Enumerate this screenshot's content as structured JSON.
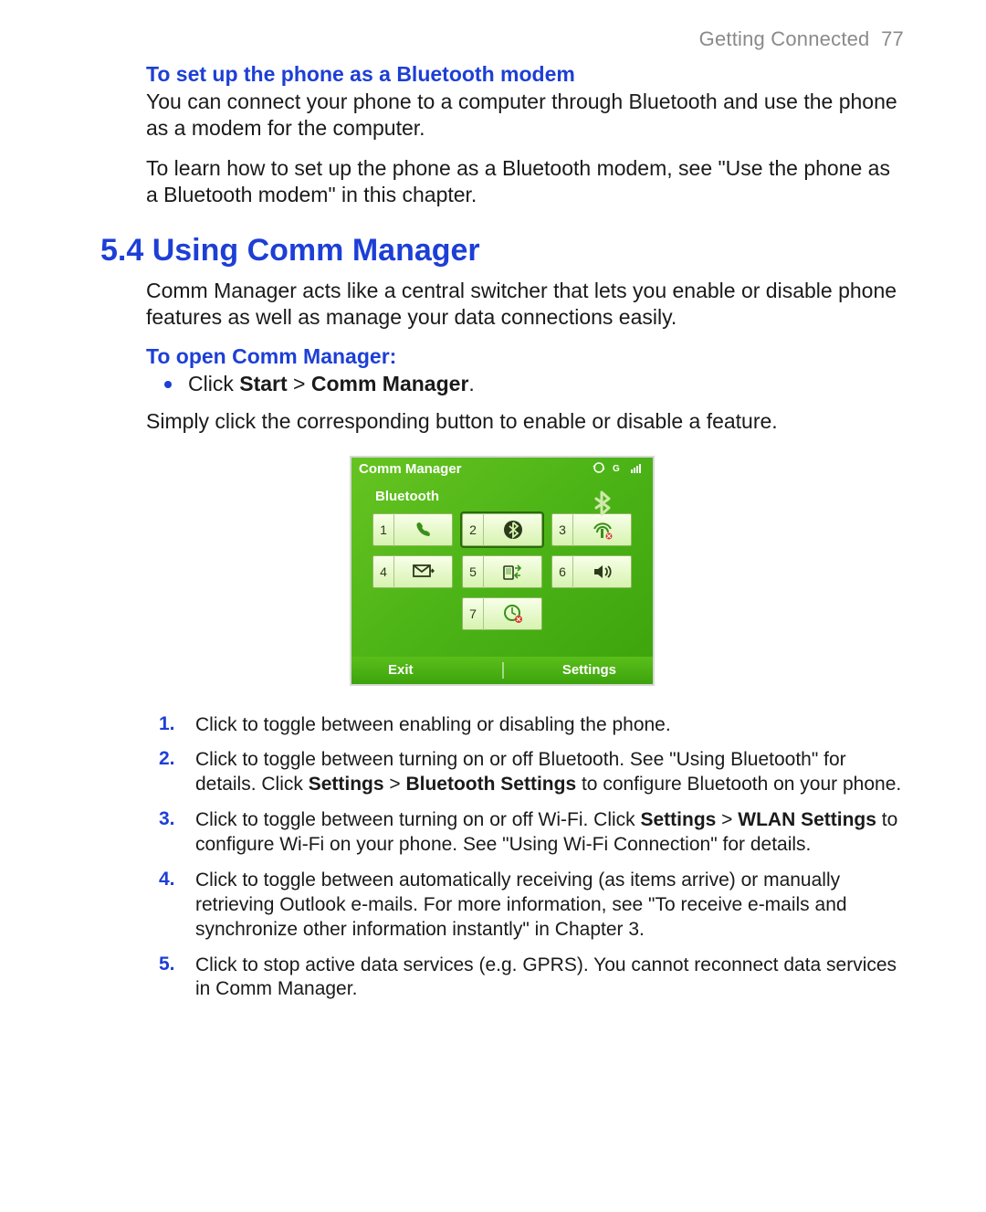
{
  "header": {
    "section": "Getting Connected",
    "page": "77"
  },
  "bluetooth_modem": {
    "heading": "To set up the phone as a Bluetooth modem",
    "p1": "You can connect your phone to a computer through Bluetooth and use the phone as a modem for the computer.",
    "p2": "To learn how to set up the phone as a Bluetooth modem, see \"Use the phone as a Bluetooth modem\" in this chapter."
  },
  "comm_manager": {
    "heading": "5.4 Using Comm Manager",
    "intro": "Comm Manager acts like a central switcher that lets you enable or disable phone features as well as manage your data connections easily.",
    "open_heading": "To open Comm Manager:",
    "bullet_prefix": "Click ",
    "bullet_bold1": "Start",
    "bullet_sep": " > ",
    "bullet_bold2": "Comm Manager",
    "bullet_suffix": ".",
    "post_bullet": "Simply click the corresponding button to enable or disable a feature."
  },
  "figure": {
    "title": "Comm Manager",
    "selected": "Bluetooth",
    "buttons": {
      "b1": "1",
      "b2": "2",
      "b3": "3",
      "b4": "4",
      "b5": "5",
      "b6": "6",
      "b7": "7"
    },
    "soft_left": "Exit",
    "soft_right": "Settings"
  },
  "list": {
    "n1": "1.",
    "n2": "2.",
    "n3": "3.",
    "n4": "4.",
    "n5": "5.",
    "t1": "Click to toggle between enabling or disabling the phone.",
    "t2a": "Click to toggle between turning on or off Bluetooth. See \"Using Bluetooth\" for details. Click ",
    "t2b1": "Settings",
    "t2sep": " > ",
    "t2b2": "Bluetooth Settings",
    "t2c": " to configure Bluetooth on your phone.",
    "t3a": "Click to toggle between turning on or off Wi-Fi. Click ",
    "t3b1": "Settings",
    "t3sep": " > ",
    "t3b2": "WLAN Settings",
    "t3c": " to configure Wi-Fi on your phone. See \"Using Wi-Fi Connection\" for details.",
    "t4": "Click to toggle between automatically receiving (as items arrive) or manually retrieving Outlook e-mails. For more information, see \"To receive e-mails and synchronize other information instantly\" in Chapter 3.",
    "t5": "Click to stop active data services (e.g. GPRS). You cannot reconnect data services in Comm Manager."
  }
}
